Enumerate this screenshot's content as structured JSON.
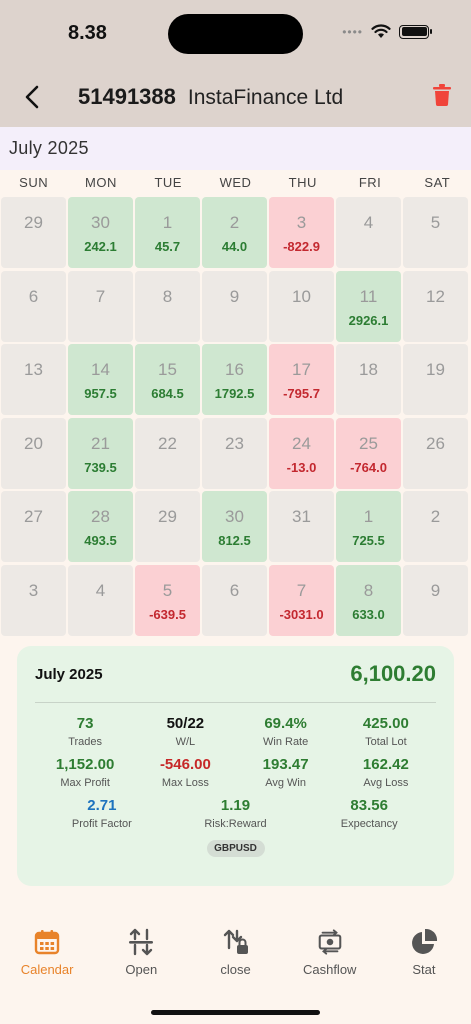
{
  "status_bar": {
    "time": "8.38"
  },
  "header": {
    "account_id": "51491388",
    "broker": "InstaFinance Ltd"
  },
  "month_label": "July 2025",
  "weekdays": [
    "SUN",
    "MON",
    "TUE",
    "WED",
    "THU",
    "FRI",
    "SAT"
  ],
  "calendar": {
    "days": [
      {
        "day": "29",
        "pnl": "",
        "status": "neutral"
      },
      {
        "day": "30",
        "pnl": "242.1",
        "status": "profit"
      },
      {
        "day": "1",
        "pnl": "45.7",
        "status": "profit"
      },
      {
        "day": "2",
        "pnl": "44.0",
        "status": "profit"
      },
      {
        "day": "3",
        "pnl": "-822.9",
        "status": "loss"
      },
      {
        "day": "4",
        "pnl": "",
        "status": "neutral"
      },
      {
        "day": "5",
        "pnl": "",
        "status": "neutral"
      },
      {
        "day": "6",
        "pnl": "",
        "status": "neutral"
      },
      {
        "day": "7",
        "pnl": "",
        "status": "neutral"
      },
      {
        "day": "8",
        "pnl": "",
        "status": "neutral"
      },
      {
        "day": "9",
        "pnl": "",
        "status": "neutral"
      },
      {
        "day": "10",
        "pnl": "",
        "status": "neutral"
      },
      {
        "day": "11",
        "pnl": "2926.1",
        "status": "profit"
      },
      {
        "day": "12",
        "pnl": "",
        "status": "neutral"
      },
      {
        "day": "13",
        "pnl": "",
        "status": "neutral"
      },
      {
        "day": "14",
        "pnl": "957.5",
        "status": "profit"
      },
      {
        "day": "15",
        "pnl": "684.5",
        "status": "profit"
      },
      {
        "day": "16",
        "pnl": "1792.5",
        "status": "profit"
      },
      {
        "day": "17",
        "pnl": "-795.7",
        "status": "loss"
      },
      {
        "day": "18",
        "pnl": "",
        "status": "neutral"
      },
      {
        "day": "19",
        "pnl": "",
        "status": "neutral"
      },
      {
        "day": "20",
        "pnl": "",
        "status": "neutral"
      },
      {
        "day": "21",
        "pnl": "739.5",
        "status": "profit"
      },
      {
        "day": "22",
        "pnl": "",
        "status": "neutral"
      },
      {
        "day": "23",
        "pnl": "",
        "status": "neutral"
      },
      {
        "day": "24",
        "pnl": "-13.0",
        "status": "loss"
      },
      {
        "day": "25",
        "pnl": "-764.0",
        "status": "loss"
      },
      {
        "day": "26",
        "pnl": "",
        "status": "neutral"
      },
      {
        "day": "27",
        "pnl": "",
        "status": "neutral"
      },
      {
        "day": "28",
        "pnl": "493.5",
        "status": "profit"
      },
      {
        "day": "29",
        "pnl": "",
        "status": "neutral"
      },
      {
        "day": "30",
        "pnl": "812.5",
        "status": "profit"
      },
      {
        "day": "31",
        "pnl": "",
        "status": "neutral"
      },
      {
        "day": "1",
        "pnl": "725.5",
        "status": "profit"
      },
      {
        "day": "2",
        "pnl": "",
        "status": "neutral"
      },
      {
        "day": "3",
        "pnl": "",
        "status": "neutral"
      },
      {
        "day": "4",
        "pnl": "",
        "status": "neutral"
      },
      {
        "day": "5",
        "pnl": "-639.5",
        "status": "loss"
      },
      {
        "day": "6",
        "pnl": "",
        "status": "neutral"
      },
      {
        "day": "7",
        "pnl": "-3031.0",
        "status": "loss"
      },
      {
        "day": "8",
        "pnl": "633.0",
        "status": "profit"
      },
      {
        "day": "9",
        "pnl": "",
        "status": "neutral"
      }
    ]
  },
  "summary": {
    "month": "July 2025",
    "total": "6,100.20",
    "rows": [
      [
        {
          "value": "73",
          "label": "Trades",
          "color": "green"
        },
        {
          "value": "50/22",
          "label": "W/L",
          "color": "dark"
        },
        {
          "value": "69.4%",
          "label": "Win Rate",
          "color": "green"
        },
        {
          "value": "425.00",
          "label": "Total Lot",
          "color": "green"
        }
      ],
      [
        {
          "value": "1,152.00",
          "label": "Max Profit",
          "color": "green"
        },
        {
          "value": "-546.00",
          "label": "Max Loss",
          "color": "red"
        },
        {
          "value": "193.47",
          "label": "Avg Win",
          "color": "green"
        },
        {
          "value": "162.42",
          "label": "Avg Loss",
          "color": "green"
        }
      ],
      [
        {
          "value": "2.71",
          "label": "Profit Factor",
          "color": "blue"
        },
        {
          "value": "1.19",
          "label": "Risk:Reward",
          "color": "green"
        },
        {
          "value": "83.56",
          "label": "Expectancy",
          "color": "green"
        }
      ]
    ],
    "pair": "GBPUSD"
  },
  "tabs": [
    {
      "label": "Calendar",
      "icon": "calendar-icon",
      "active": true
    },
    {
      "label": "Open",
      "icon": "open-trades-icon",
      "active": false
    },
    {
      "label": "close",
      "icon": "closed-trades-icon",
      "active": false
    },
    {
      "label": "Cashflow",
      "icon": "cashflow-icon",
      "active": false
    },
    {
      "label": "Stat",
      "icon": "pie-chart-icon",
      "active": false
    }
  ],
  "colors": {
    "profit_bg": "#cfe7d0",
    "loss_bg": "#fbd0d3",
    "profit_text": "#2c7d33",
    "loss_text": "#c3282f",
    "accent": "#e8832a",
    "delete": "#f0443a"
  }
}
